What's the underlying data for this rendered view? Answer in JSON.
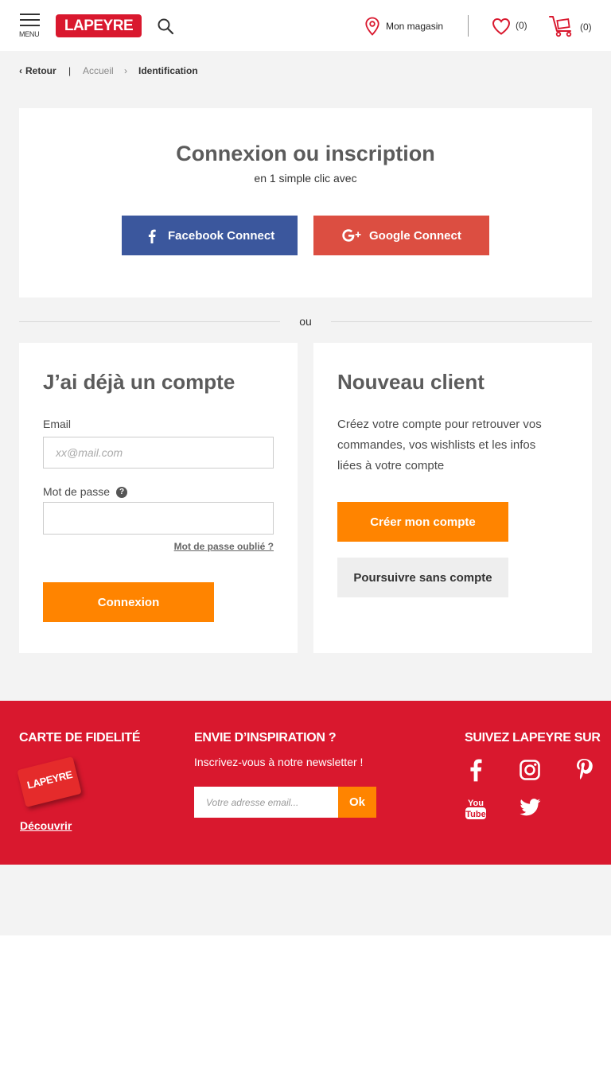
{
  "header": {
    "menu_label": "MENU",
    "logo_text": "LAPEYRE",
    "store_label": "Mon magasin",
    "wishlist_count": "(0)",
    "cart_count": "(0)"
  },
  "breadcrumb": {
    "back": "Retour",
    "separator": "|",
    "home": "Accueil",
    "current": "Identification"
  },
  "social": {
    "title": "Connexion ou inscription",
    "subtitle": "en 1 simple clic avec",
    "facebook_label": "Facebook Connect",
    "google_label": "Google Connect",
    "facebook_color": "#3b579d",
    "google_color": "#dc4e41"
  },
  "divider": {
    "text": "ou"
  },
  "login": {
    "title": "J’ai déjà un compte",
    "email_label": "Email",
    "email_placeholder": "xx@mail.com",
    "email_value": "",
    "password_label": "Mot de passe",
    "password_value": "",
    "help_icon": "?",
    "forgot_link": "Mot de passe oublié ?",
    "submit_label": "Connexion"
  },
  "new_client": {
    "title": "Nouveau client",
    "description": "Créez votre compte pour retrouver vos commandes, vos wishlists et les infos liées à votre compte",
    "create_label": "Créer mon compte",
    "guest_label": "Poursuivre sans compte"
  },
  "footer": {
    "loyalty_title": "CARTE DE FIDELITÉ",
    "loyalty_card_text": "LAPEYRE",
    "discover_link": "Découvrir",
    "newsletter_title": "ENVIE D’INSPIRATION ?",
    "newsletter_sub": "Inscrivez-vous à notre newsletter !",
    "newsletter_placeholder": "Votre adresse email...",
    "newsletter_ok": "Ok",
    "social_title": "SUIVEZ LAPEYRE SUR",
    "social_icons": [
      "facebook-icon",
      "instagram-icon",
      "pinterest-icon",
      "youtube-icon",
      "twitter-icon"
    ]
  },
  "colors": {
    "brand_red": "#d9182e",
    "accent_orange": "#ff8400",
    "background": "#f3f3f3"
  }
}
